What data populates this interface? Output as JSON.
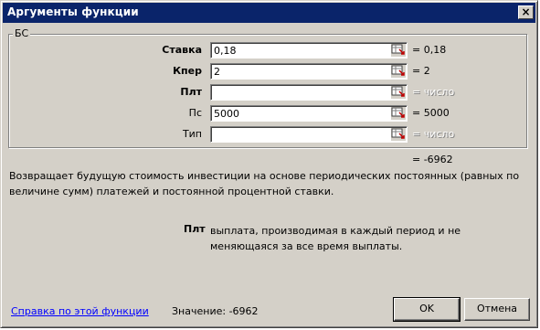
{
  "window": {
    "title": "Аргументы функции",
    "close_glyph": "×"
  },
  "function_group": {
    "name": "БС"
  },
  "arguments": [
    {
      "label": "Ставка",
      "value": "0,18",
      "result": "= 0,18"
    },
    {
      "label": "Кпер",
      "value": "2",
      "result": "= 2"
    },
    {
      "label": "Плт",
      "value": "",
      "result": "= число"
    },
    {
      "label": "Пс",
      "value": "5000",
      "result": "= 5000"
    },
    {
      "label": "Тип",
      "value": "",
      "result": "= число"
    }
  ],
  "formula_result": "= -6962",
  "description": "Возвращает будущую стоимость инвестиции на основе периодических постоянных (равных по величине сумм) платежей и постоянной процентной ставки.",
  "argument_help": {
    "name": "Плт",
    "text": "выплата, производимая в каждый период и не меняющаяся за все время выплаты."
  },
  "footer": {
    "help_link": "Справка по этой функции",
    "value_text": "Значение: -6962",
    "ok_label": "OK",
    "cancel_label": "Отмена"
  },
  "icons": {
    "collapse": "range-collapse-icon"
  }
}
